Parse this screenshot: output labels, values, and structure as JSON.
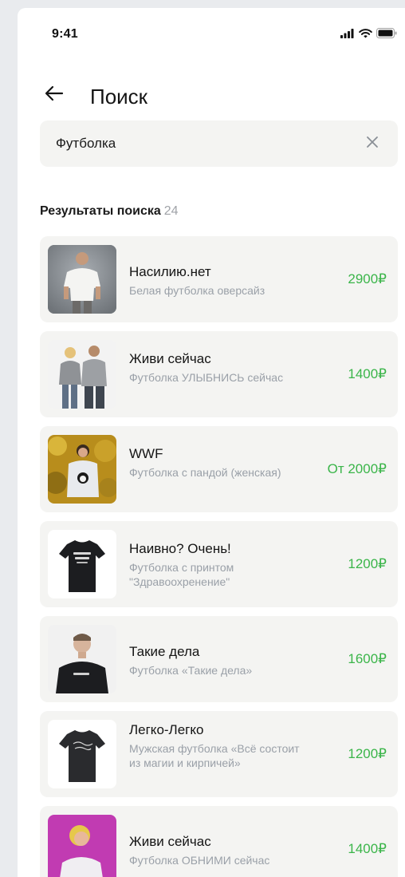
{
  "status_bar": {
    "time": "9:41",
    "icons": [
      "signal-icon",
      "wifi-icon",
      "battery-icon"
    ]
  },
  "header": {
    "back_icon": "arrow-left-icon",
    "title": "Поиск"
  },
  "search": {
    "value": "Футболка",
    "clear_icon": "close-icon"
  },
  "results": {
    "heading": "Результаты поиска",
    "count": "24",
    "items": [
      {
        "title": "Насилию.нет",
        "subtitle": "Белая футболка оверсайз",
        "price": "2900₽",
        "thumbnail": "man-white-tshirt-photo"
      },
      {
        "title": "Живи сейчас",
        "subtitle": "Футболка УЛЫБНИСЬ сейчас",
        "price": "1400₽",
        "thumbnail": "couple-grey-tshirts-photo"
      },
      {
        "title": "WWF",
        "subtitle": "Футболка с пандой (женская)",
        "price": "От 2000₽",
        "thumbnail": "woman-panda-tshirt-photo"
      },
      {
        "title": "Наивно? Очень!",
        "subtitle": "Футболка с принтом \"Здравоохренение\"",
        "price": "1200₽",
        "thumbnail": "black-tshirt-print-photo"
      },
      {
        "title": "Такие дела",
        "subtitle": "Футболка «Такие дела»",
        "price": "1600₽",
        "thumbnail": "man-black-tshirt-photo"
      },
      {
        "title": "Легко-Легко",
        "subtitle": "Мужская футболка «Всё состоит из магии и кирпичей»",
        "price": "1200₽",
        "thumbnail": "black-tshirt-script-photo"
      },
      {
        "title": "Живи сейчас",
        "subtitle": "Футболка ОБНИМИ сейчас",
        "price": "1400₽",
        "thumbnail": "woman-pink-background-photo"
      }
    ]
  },
  "colors": {
    "price": "#3bb54a",
    "subtitle": "#9aa0a8",
    "card_background": "#f4f4f2"
  }
}
